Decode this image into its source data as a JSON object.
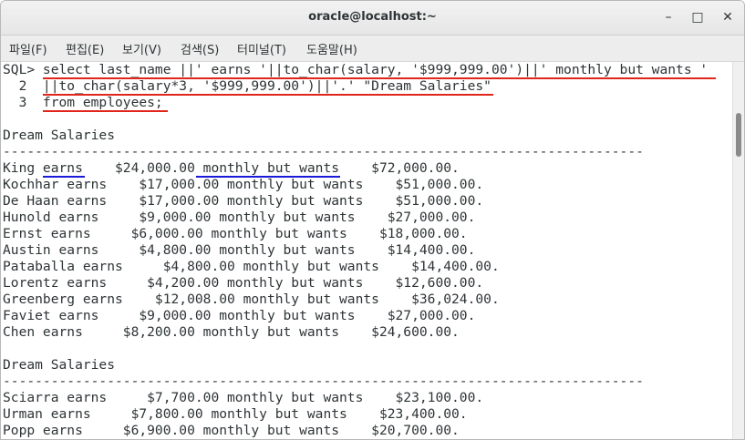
{
  "window": {
    "title": "oracle@localhost:~",
    "minimize_glyph": "–",
    "maximize_glyph": "□",
    "close_glyph": "✕"
  },
  "menu": {
    "items": [
      "파일(F)",
      "편집(E)",
      "보기(V)",
      "검색(S)",
      "터미널(T)",
      "도움말(H)"
    ]
  },
  "terminal": {
    "lines": [
      "SQL> select last_name ||' earns '||to_char(salary, '$999,999.00')||' monthly but wants '",
      "  2  ||to_char(salary*3, '$999,999.00')||'.' \"Dream Salaries\"",
      "  3  from employees;",
      "",
      "Dream Salaries",
      "--------------------------------------------------------------------------------",
      "King earns    $24,000.00 monthly but wants    $72,000.00.",
      "Kochhar earns    $17,000.00 monthly but wants    $51,000.00.",
      "De Haan earns    $17,000.00 monthly but wants    $51,000.00.",
      "Hunold earns     $9,000.00 monthly but wants    $27,000.00.",
      "Ernst earns     $6,000.00 monthly but wants    $18,000.00.",
      "Austin earns     $4,800.00 monthly but wants    $14,400.00.",
      "Pataballa earns     $4,800.00 monthly but wants    $14,400.00.",
      "Lorentz earns     $4,200.00 monthly but wants    $12,600.00.",
      "Greenberg earns    $12,008.00 monthly but wants    $36,024.00.",
      "Faviet earns     $9,000.00 monthly but wants    $27,000.00.",
      "Chen earns     $8,200.00 monthly but wants    $24,600.00.",
      "",
      "Dream Salaries",
      "--------------------------------------------------------------------------------",
      "Sciarra earns     $7,700.00 monthly but wants    $23,100.00.",
      "Urman earns     $7,800.00 monthly but wants    $23,400.00.",
      "Popp earns     $6,900.00 monthly but wants    $20,700.00."
    ]
  },
  "colors": {
    "red_underline": "#e0261b",
    "blue_underline": "#1a1adb",
    "terminal_text": "#2e3436"
  }
}
